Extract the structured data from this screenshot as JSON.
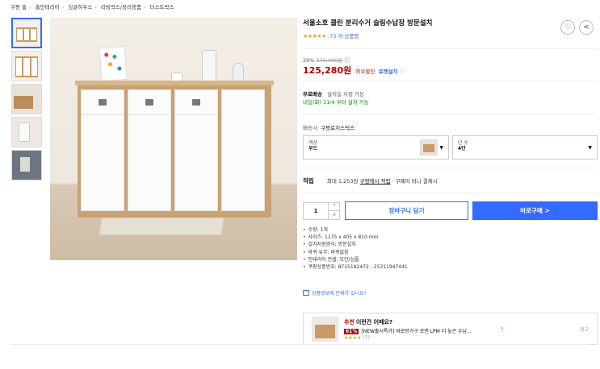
{
  "breadcrumb": [
    "쿠팡 홈",
    "홈인테리어",
    "싱글하우스",
    "리빙박스/정리용품",
    "더스트박스"
  ],
  "product": {
    "title": "서울소호 클린 분리수거 슬림수납장 방문설치",
    "stars": "★★★★★",
    "review_count": "73 개 상품평",
    "discount_pct": "26%",
    "original_price": "170,000원",
    "price": "125,280원",
    "wow_label": "와우할인",
    "rocket_label": "로켓설치"
  },
  "shipping": {
    "free_label": "무료배송",
    "free_note": "설치일 지정 가능",
    "arrival": "내일(화) 11/4 부터 설치 가능"
  },
  "seller": {
    "label": "배송사:",
    "name": "쿠팡로지스틱스"
  },
  "options": {
    "color_label": "색상",
    "color_value": "우드",
    "tier_label": "단 수",
    "tier_value": "4단"
  },
  "reward": {
    "label": "적립",
    "text_before": "최대 1,253원",
    "link": "쿠팡캐시 적립",
    "text_after": "· 쿠페이 머니 결제시"
  },
  "purchase": {
    "quantity": "1",
    "cart_label": "장바구니 담기",
    "buy_label": "바로구매 >"
  },
  "specs": [
    "수량: 1개",
    "사이즈: 1175 x 405 x 810 mm",
    "설치지원방식: 방문설치",
    "바퀴 유무: 바퀴없음",
    "인테리어 컨셉: 모던/심플",
    "쿠팡상품번호: 8715192472 - 25311947441"
  ],
  "report_text": "상품정보에 문제가 있나요?",
  "recommend": {
    "badge": "추천",
    "heading": "이런건 어때요?",
    "discount": "61%",
    "desc": "[NEW출시특가] 바로방가구 로엔 LPM 더 높은 수납...",
    "stars": "★★★★",
    "count": "(7)",
    "ad_label": "광고"
  },
  "colors": {
    "accent": "#346aff",
    "price_red": "#ae0000",
    "delivery_green": "#00891a",
    "star": "#f0a216"
  },
  "icons": [
    "heart-icon",
    "share-icon",
    "chevron-down-icon",
    "report-icon",
    "chevron-right-icon"
  ]
}
